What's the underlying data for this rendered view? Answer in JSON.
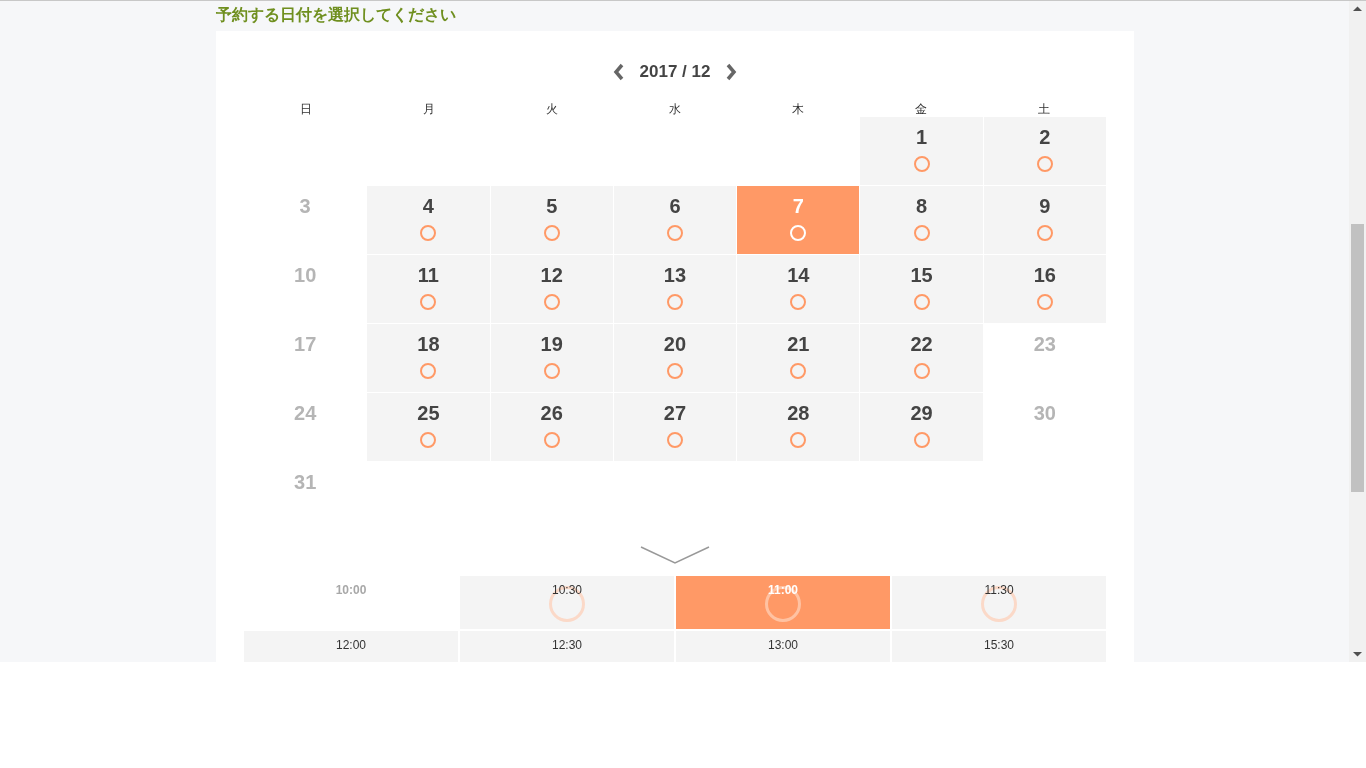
{
  "heading": "予約する日付を選択してください",
  "calendar": {
    "month": "2017 / 12",
    "weekdays": [
      "日",
      "月",
      "火",
      "水",
      "木",
      "金",
      "土"
    ],
    "cells": [
      {
        "kind": "empty"
      },
      {
        "kind": "empty"
      },
      {
        "kind": "empty"
      },
      {
        "kind": "empty"
      },
      {
        "kind": "empty"
      },
      {
        "kind": "day",
        "day": "1",
        "available": true,
        "selected": false
      },
      {
        "kind": "day",
        "day": "2",
        "available": true,
        "selected": false
      },
      {
        "kind": "day",
        "day": "3",
        "available": false,
        "selected": false
      },
      {
        "kind": "day",
        "day": "4",
        "available": true,
        "selected": false
      },
      {
        "kind": "day",
        "day": "5",
        "available": true,
        "selected": false
      },
      {
        "kind": "day",
        "day": "6",
        "available": true,
        "selected": false
      },
      {
        "kind": "day",
        "day": "7",
        "available": true,
        "selected": true
      },
      {
        "kind": "day",
        "day": "8",
        "available": true,
        "selected": false
      },
      {
        "kind": "day",
        "day": "9",
        "available": true,
        "selected": false
      },
      {
        "kind": "day",
        "day": "10",
        "available": false,
        "selected": false
      },
      {
        "kind": "day",
        "day": "11",
        "available": true,
        "selected": false
      },
      {
        "kind": "day",
        "day": "12",
        "available": true,
        "selected": false
      },
      {
        "kind": "day",
        "day": "13",
        "available": true,
        "selected": false
      },
      {
        "kind": "day",
        "day": "14",
        "available": true,
        "selected": false
      },
      {
        "kind": "day",
        "day": "15",
        "available": true,
        "selected": false
      },
      {
        "kind": "day",
        "day": "16",
        "available": true,
        "selected": false
      },
      {
        "kind": "day",
        "day": "17",
        "available": false,
        "selected": false
      },
      {
        "kind": "day",
        "day": "18",
        "available": true,
        "selected": false
      },
      {
        "kind": "day",
        "day": "19",
        "available": true,
        "selected": false
      },
      {
        "kind": "day",
        "day": "20",
        "available": true,
        "selected": false
      },
      {
        "kind": "day",
        "day": "21",
        "available": true,
        "selected": false
      },
      {
        "kind": "day",
        "day": "22",
        "available": true,
        "selected": false
      },
      {
        "kind": "day",
        "day": "23",
        "available": false,
        "selected": false
      },
      {
        "kind": "day",
        "day": "24",
        "available": false,
        "selected": false
      },
      {
        "kind": "day",
        "day": "25",
        "available": true,
        "selected": false
      },
      {
        "kind": "day",
        "day": "26",
        "available": true,
        "selected": false
      },
      {
        "kind": "day",
        "day": "27",
        "available": true,
        "selected": false
      },
      {
        "kind": "day",
        "day": "28",
        "available": true,
        "selected": false
      },
      {
        "kind": "day",
        "day": "29",
        "available": true,
        "selected": false
      },
      {
        "kind": "day",
        "day": "30",
        "available": false,
        "selected": false
      },
      {
        "kind": "day",
        "day": "31",
        "available": false,
        "selected": false
      }
    ]
  },
  "times": [
    {
      "label": "10:00",
      "available": false,
      "selected": false
    },
    {
      "label": "10:30",
      "available": true,
      "selected": false
    },
    {
      "label": "11:00",
      "available": true,
      "selected": true
    },
    {
      "label": "11:30",
      "available": true,
      "selected": false
    },
    {
      "label": "12:00",
      "available": true,
      "selected": false
    },
    {
      "label": "12:30",
      "available": true,
      "selected": false
    },
    {
      "label": "13:00",
      "available": true,
      "selected": false
    },
    {
      "label": "15:30",
      "available": true,
      "selected": false
    }
  ]
}
